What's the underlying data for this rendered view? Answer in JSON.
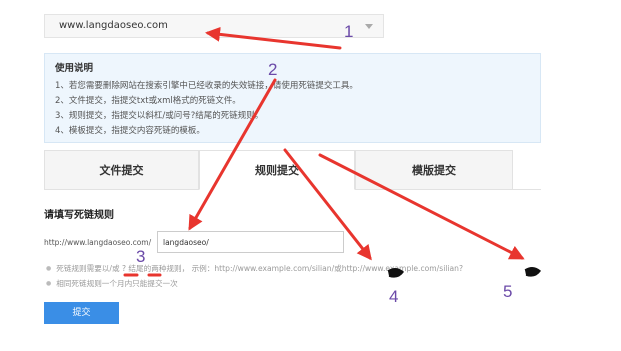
{
  "site_select": {
    "value": "www.langdaoseo.com"
  },
  "instructions": {
    "title": "使用说明",
    "items": [
      "1、若您需要删除网站在搜索引擎中已经收录的失效链接，请使用死链提交工具。",
      "2、文件提交，指提交txt或xml格式的死链文件。",
      "3、规则提交，指提交以斜杠/或问号?结尾的死链规则。",
      "4、模板提交，指提交内容死链的模板。"
    ]
  },
  "tabs": [
    "文件提交",
    "规则提交",
    "模版提交"
  ],
  "form": {
    "section_title": "请填写死链规则",
    "prefix": "http://www.langdaoseo.com/",
    "rule_value": "langdaoseo/",
    "notes": [
      "死链规则需要以/或 ? 结尾的两种规则， 示例：http://www.example.com/silian/或http://www.example.com/silian?",
      "相同死链规则一个月内只能提交一次"
    ],
    "submit_label": "提交"
  },
  "annotations": [
    "1",
    "2",
    "3",
    "4",
    "5"
  ],
  "colors": {
    "arrow": "#e8352e",
    "number": "#6b4aa8",
    "primary": "#3a8ee6"
  }
}
